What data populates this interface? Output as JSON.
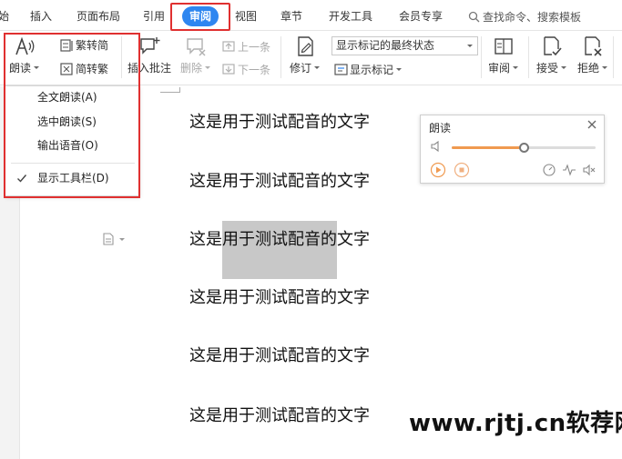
{
  "menu": {
    "items": [
      "始",
      "插入",
      "页面布局",
      "引用",
      "审阅",
      "视图",
      "章节",
      "开发工具",
      "会员专享"
    ],
    "active_index": 4,
    "search_placeholder": "查找命令、搜索模板"
  },
  "ribbon": {
    "read_aloud": "朗读",
    "trad_to_simp": "繁转简",
    "simp_to_trad": "简转繁",
    "insert_comment": "插入批注",
    "delete": "删除",
    "prev": "上一条",
    "next": "下一条",
    "track_changes": "修订",
    "markup_state": "显示标记的最终状态",
    "show_markup": "显示标记",
    "review": "审阅",
    "accept": "接受",
    "reject": "拒绝"
  },
  "dropdown": {
    "items": [
      "全文朗读(A)",
      "选中朗读(S)",
      "输出语音(O)",
      "显示工具栏(D)"
    ],
    "checked_index": 3
  },
  "document": {
    "lines": [
      "这是用于测试配音的文字",
      "这是用于测试配音的文字",
      "这是用于测试配音的文字",
      "这是用于测试配音的文字",
      "这是用于测试配音的文字",
      "这是用于测试配音的文字"
    ],
    "selected_line_index": 2,
    "selected_start": 2,
    "selected_end": 9
  },
  "panel": {
    "title": "朗读",
    "volume_fraction": 0.5
  },
  "watermark": "www.rjtj.cn软荐网",
  "colors": {
    "accent": "#2e86f0",
    "highlight_box": "#e03030",
    "slider_fill": "#f09a50",
    "selection": "#c8c8c8"
  }
}
